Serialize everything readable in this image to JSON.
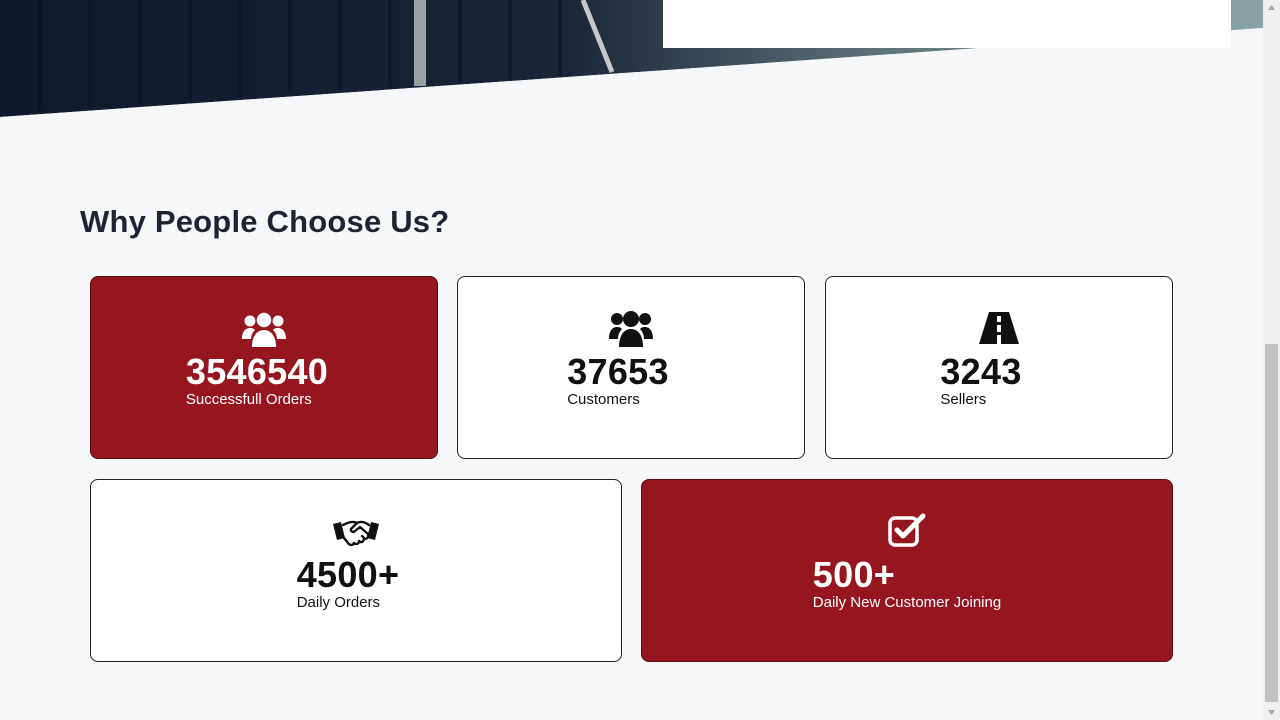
{
  "section": {
    "title": "Why People Choose Us?"
  },
  "stats": [
    {
      "number": "3546540",
      "label": "Successfull Orders",
      "icon": "users-icon",
      "highlight": true
    },
    {
      "number": "37653",
      "label": "Customers",
      "icon": "users-icon",
      "highlight": false
    },
    {
      "number": "3243",
      "label": "Sellers",
      "icon": "road-icon",
      "highlight": false
    },
    {
      "number": "4500+",
      "label": "Daily Orders",
      "icon": "handshake-icon",
      "highlight": false
    },
    {
      "number": "500+",
      "label": "Daily New Customer Joining",
      "icon": "check-square-icon",
      "highlight": true
    }
  ],
  "colors": {
    "accent": "#96161f",
    "background": "#f6f7f9",
    "heading": "#1e2433"
  }
}
